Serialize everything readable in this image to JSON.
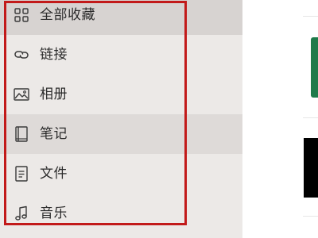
{
  "sidebar": {
    "items": [
      {
        "label": "全部收藏",
        "icon": "grid-icon",
        "state": "selected"
      },
      {
        "label": "链接",
        "icon": "link-icon",
        "state": "normal"
      },
      {
        "label": "相册",
        "icon": "image-icon",
        "state": "normal"
      },
      {
        "label": "笔记",
        "icon": "notebook-icon",
        "state": "hover"
      },
      {
        "label": "文件",
        "icon": "file-icon",
        "state": "normal"
      },
      {
        "label": "音乐",
        "icon": "music-icon",
        "state": "normal"
      }
    ]
  },
  "colors": {
    "sidebar_background": "#ece9e7",
    "selected_background": "#d7d3d1",
    "hover_background": "#dedad8",
    "highlight_border": "#c21a1a",
    "text": "#2b2b2b",
    "content_green_tile": "#1f7a4a",
    "content_black_tile": "#000000"
  }
}
